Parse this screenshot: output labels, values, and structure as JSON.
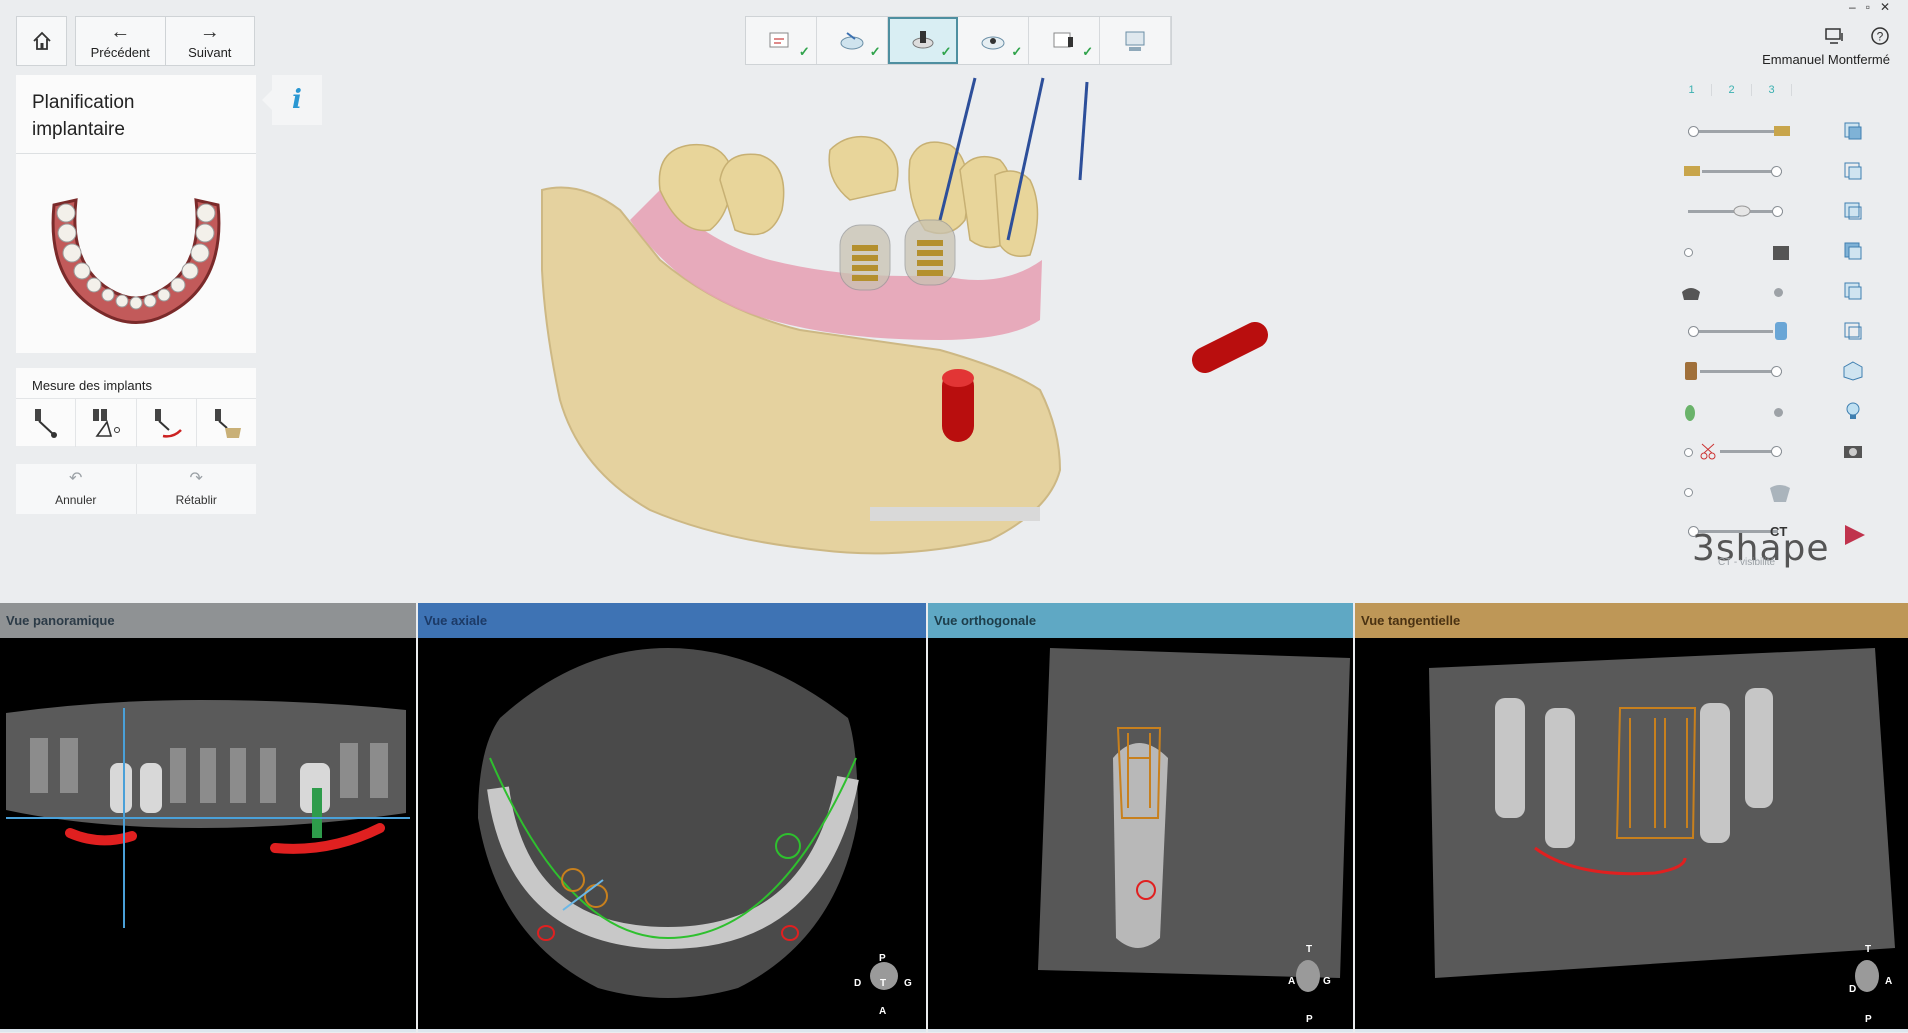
{
  "toolbar": {
    "prev_label": "Précédent",
    "next_label": "Suivant"
  },
  "panel": {
    "title": "Planification implantaire"
  },
  "measure": {
    "title": "Mesure des implants"
  },
  "history": {
    "undo_label": "Annuler",
    "redo_label": "Rétablir"
  },
  "workflow": {
    "steps": [
      "step-1",
      "step-2",
      "step-3",
      "step-4",
      "step-5",
      "step-6"
    ],
    "active_step": 3
  },
  "user": {
    "name": "Emmanuel Montfermé"
  },
  "layers": {
    "columns": [
      "1",
      "2",
      "3"
    ],
    "ct_label": "CT",
    "ct_visibility": "CT - visibilité"
  },
  "brand": {
    "logo": "3shape"
  },
  "views": {
    "panoramic": {
      "title": "Vue panoramique",
      "color": "#8f9294"
    },
    "axial": {
      "title": "Vue axiale",
      "color": "#3e73b4"
    },
    "orthogonal": {
      "title": "Vue orthogonale",
      "color": "#5fa8c4"
    },
    "tangential": {
      "title": "Vue tangentielle",
      "color": "#be9757"
    }
  },
  "orientation": {
    "axial": {
      "top": "P",
      "left": "D",
      "center": "T",
      "right": "G",
      "bottom": "A"
    },
    "orthogonal": {
      "top": "T",
      "left": "A",
      "right": "G",
      "bottom": "P"
    },
    "tangential": {
      "top": "T",
      "left": "D",
      "right": "A",
      "bottom": "P"
    }
  }
}
